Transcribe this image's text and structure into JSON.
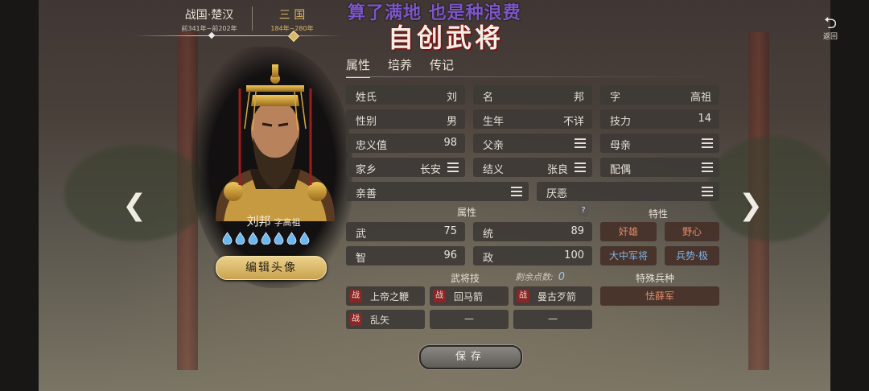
{
  "eras": [
    {
      "name": "战国·楚汉",
      "years": "前341年~前202年",
      "active": false
    },
    {
      "name": "三 国",
      "years": "184年~280年",
      "active": true
    }
  ],
  "banner": "算了满地 也是种浪费",
  "title": "自创武将",
  "back_label": "返回",
  "hero": {
    "name": "刘邦",
    "style": "字高祖",
    "drops": 7
  },
  "edit_portrait_label": "编辑头像",
  "tabs": [
    {
      "label": "属性",
      "active": true
    },
    {
      "label": "培养",
      "active": false
    },
    {
      "label": "传记",
      "active": false
    }
  ],
  "info": {
    "surname": {
      "label": "姓氏",
      "value": "刘"
    },
    "given": {
      "label": "名",
      "value": "邦"
    },
    "courtesy": {
      "label": "字",
      "value": "高祖"
    },
    "gender": {
      "label": "性别",
      "value": "男"
    },
    "birth": {
      "label": "生年",
      "value": "不详"
    },
    "skill_power": {
      "label": "技力",
      "value": "14"
    },
    "loyalty": {
      "label": "忠义值",
      "value": "98"
    },
    "father": {
      "label": "父亲",
      "value": ""
    },
    "mother": {
      "label": "母亲",
      "value": ""
    },
    "hometown": {
      "label": "家乡",
      "value": "长安"
    },
    "sworn": {
      "label": "结义",
      "value": "张良"
    },
    "spouse": {
      "label": "配偶",
      "value": ""
    },
    "friendly": {
      "label": "亲善",
      "value": ""
    },
    "dislike": {
      "label": "厌恶",
      "value": ""
    }
  },
  "stats_title": "属性",
  "stats": {
    "wu": {
      "label": "武",
      "value": "75"
    },
    "tong": {
      "label": "统",
      "value": "89"
    },
    "zhi": {
      "label": "智",
      "value": "96"
    },
    "zheng": {
      "label": "政",
      "value": "100"
    }
  },
  "traits_title": "特性",
  "traits": [
    {
      "label": "奸雄",
      "color": "#e08a6a"
    },
    {
      "label": "野心",
      "color": "#e08a6a"
    },
    {
      "label": "大中军将",
      "color": "#7fb4e6"
    },
    {
      "label": "兵势·极",
      "color": "#7fb4e6"
    }
  ],
  "skills_title": "武将技",
  "remaining_label": "剩余点数:",
  "remaining_value": "0",
  "skills": [
    {
      "tag": "战",
      "name": "上帝之鞭"
    },
    {
      "tag": "战",
      "name": "回马箭"
    },
    {
      "tag": "战",
      "name": "曼古歹箭"
    },
    {
      "tag": "战",
      "name": "乱矢"
    },
    {
      "tag": "",
      "name": "—"
    },
    {
      "tag": "",
      "name": "—"
    }
  ],
  "special_troop_title": "特殊兵种",
  "special_troop": {
    "label": "怯薛军",
    "color": "#e08a6a"
  },
  "save_label": "保存"
}
